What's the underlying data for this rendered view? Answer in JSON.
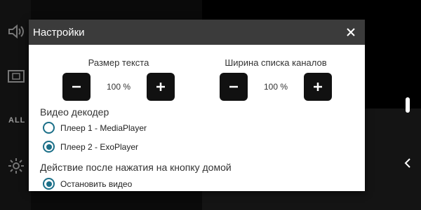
{
  "background": {
    "sidebar": {
      "items": [
        {
          "icon": "speaker-icon"
        },
        {
          "icon": "picture-in-picture-icon"
        },
        {
          "label": "ALL"
        },
        {
          "icon": "settings-gear-icon"
        }
      ]
    },
    "icons": {
      "scrollbar": "scrollbar-thumb",
      "chevron": "chevron-left-icon"
    }
  },
  "dialog": {
    "title": "Настройки",
    "close_icon": "close-icon",
    "text_size": {
      "label": "Размер текста",
      "value": "100 %",
      "decrease_icon": "minus-icon",
      "increase_icon": "plus-icon"
    },
    "channel_list_width": {
      "label": "Ширина списка каналов",
      "value": "100 %",
      "decrease_icon": "minus-icon",
      "increase_icon": "plus-icon"
    },
    "video_decoder": {
      "title": "Видео декодер",
      "options": [
        {
          "label": "Плеер 1 - MediaPlayer",
          "checked": false
        },
        {
          "label": "Плеер 2 - ExoPlayer",
          "checked": true
        }
      ]
    },
    "home_action": {
      "title": "Действие после нажатия на кнопку домой",
      "options": [
        {
          "label": "Остановить видео",
          "checked": true
        }
      ]
    }
  },
  "colors": {
    "header": "#3b3b3b",
    "accent": "#1b6f88",
    "button": "#111111"
  }
}
